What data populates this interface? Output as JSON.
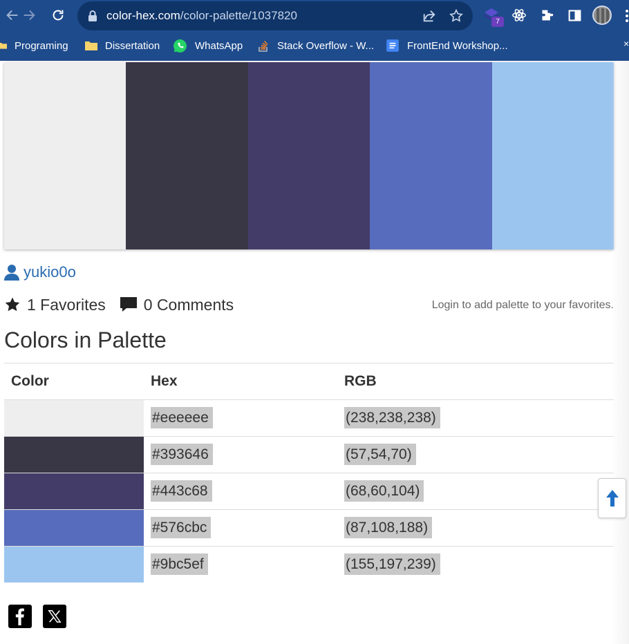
{
  "browser": {
    "url_host": "color-hex.com",
    "url_path": "/color-palette/1037820",
    "extension_badge": "7",
    "bookmarks": [
      {
        "label": "Programing",
        "icon": "folder-icon"
      },
      {
        "label": "Dissertation",
        "icon": "folder-icon"
      },
      {
        "label": "WhatsApp",
        "icon": "whatsapp-icon"
      },
      {
        "label": "Stack Overflow - W...",
        "icon": "stackoverflow-icon"
      },
      {
        "label": "FrontEnd Workshop...",
        "icon": "docs-icon"
      }
    ]
  },
  "palette": {
    "colors": [
      "#eeeeee",
      "#393646",
      "#443c68",
      "#576cbc",
      "#9bc5ef"
    ]
  },
  "author": "yukio0o",
  "stats": {
    "favorites": "1 Favorites",
    "comments": "0 Comments",
    "login_note": "Login to add palette to your favorites."
  },
  "section_title": "Colors in Palette",
  "table": {
    "headers": [
      "Color",
      "Hex",
      "RGB"
    ],
    "rows": [
      {
        "hex": "#eeeeee",
        "rgb": "(238,238,238)"
      },
      {
        "hex": "#393646",
        "rgb": "(57,54,70)"
      },
      {
        "hex": "#443c68",
        "rgb": "(68,60,104)"
      },
      {
        "hex": "#576cbc",
        "rgb": "(87,108,188)"
      },
      {
        "hex": "#9bc5ef",
        "rgb": "(155,197,239)"
      }
    ]
  },
  "social": [
    "facebook-icon",
    "x-icon"
  ]
}
